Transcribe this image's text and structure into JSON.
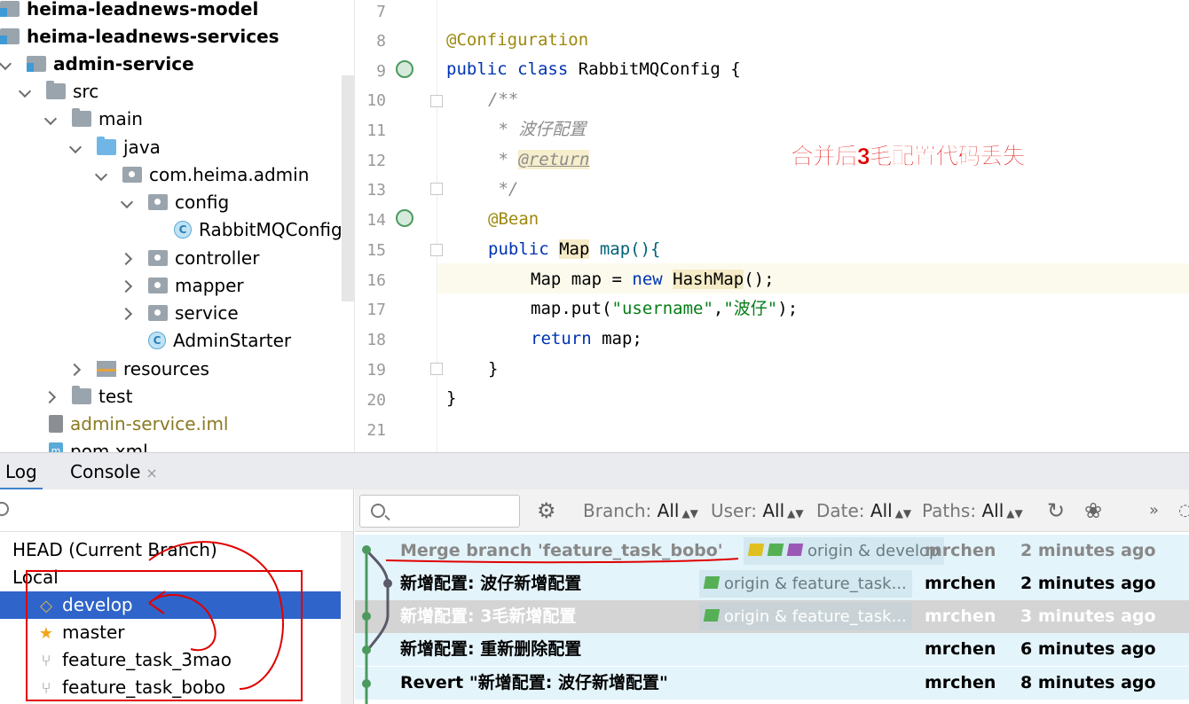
{
  "tree": {
    "items": [
      {
        "label": "heima-leadnews-model"
      },
      {
        "label": "heima-leadnews-services"
      },
      {
        "label": "admin-service"
      },
      {
        "label": "src"
      },
      {
        "label": "main"
      },
      {
        "label": "java"
      },
      {
        "label": "com.heima.admin"
      },
      {
        "label": "config"
      },
      {
        "label": "RabbitMQConfig"
      },
      {
        "label": "controller"
      },
      {
        "label": "mapper"
      },
      {
        "label": "service"
      },
      {
        "label": "AdminStarter"
      },
      {
        "label": "resources"
      },
      {
        "label": "test"
      },
      {
        "label": "admin-service.iml"
      },
      {
        "label": "pom.xml"
      }
    ]
  },
  "editor": {
    "line_numbers": [
      "7",
      "8",
      "9",
      "10",
      "11",
      "12",
      "13",
      "14",
      "15",
      "16",
      "17",
      "18",
      "19",
      "20",
      "21"
    ],
    "lines": {
      "l8": "@Configuration",
      "l9_kw": "public class ",
      "l9_name": "RabbitMQConfig {",
      "l10": "/**",
      "l11": " * 波仔配置",
      "l12_star": " * ",
      "l12_tag": "@return",
      "l13": " */",
      "l14": "@Bean",
      "l15_kw": "public ",
      "l15_type": "Map",
      "l15_rest": " map(){",
      "l16_a": "Map map = ",
      "l16_kw": "new ",
      "l16_type": "HashMap",
      "l16_rest": "();",
      "l17_a": "map.put(",
      "l17_s1": "\"username\"",
      "l17_c": ",",
      "l17_s2": "\"波仔\"",
      "l17_e": ");",
      "l18_kw": "return ",
      "l18_rest": "map;",
      "l19": "}",
      "l20": "}"
    },
    "annotation": "合并后3毛配置代码丢失"
  },
  "tabs": [
    {
      "label": "Log",
      "active": true
    },
    {
      "label": "Console",
      "active": false,
      "close": "×"
    }
  ],
  "branches": {
    "head": "HEAD (Current Branch)",
    "local": "Local",
    "items": [
      {
        "label": "develop",
        "icon": "tag-icon",
        "selected": true
      },
      {
        "label": "master",
        "icon": "star-icon",
        "selected": false
      },
      {
        "label": "feature_task_3mao",
        "icon": "branch-icon",
        "selected": false
      },
      {
        "label": "feature_task_bobo",
        "icon": "branch-icon",
        "selected": false
      }
    ]
  },
  "toolbar": {
    "branch_label": "Branch:",
    "branch_value": "All",
    "user_label": "User:",
    "user_value": "All",
    "date_label": "Date:",
    "date_value": "All",
    "paths_label": "Paths:",
    "paths_value": "All",
    "more": "»"
  },
  "commits": [
    {
      "message": "Merge branch 'feature_task_bobo'",
      "refs": "origin & develop",
      "author": "mrchen",
      "time": "2 minutes ago"
    },
    {
      "message": "新增配置: 波仔新增配置",
      "refs": "origin & feature_task...",
      "author": "mrchen",
      "time": "2 minutes ago"
    },
    {
      "message": "新增配置: 3毛新增配置",
      "refs": "origin & feature_task...",
      "author": "mrchen",
      "time": "3 minutes ago"
    },
    {
      "message": "新增配置: 重新删除配置",
      "refs": "",
      "author": "mrchen",
      "time": "6 minutes ago"
    },
    {
      "message": "Revert \"新增配置: 波仔新增配置\"",
      "refs": "",
      "author": "mrchen",
      "time": "8 minutes ago"
    }
  ],
  "colors": {
    "accent": "#2f65ca",
    "annotation": "#e00000",
    "graph": "#4c9a5e"
  }
}
